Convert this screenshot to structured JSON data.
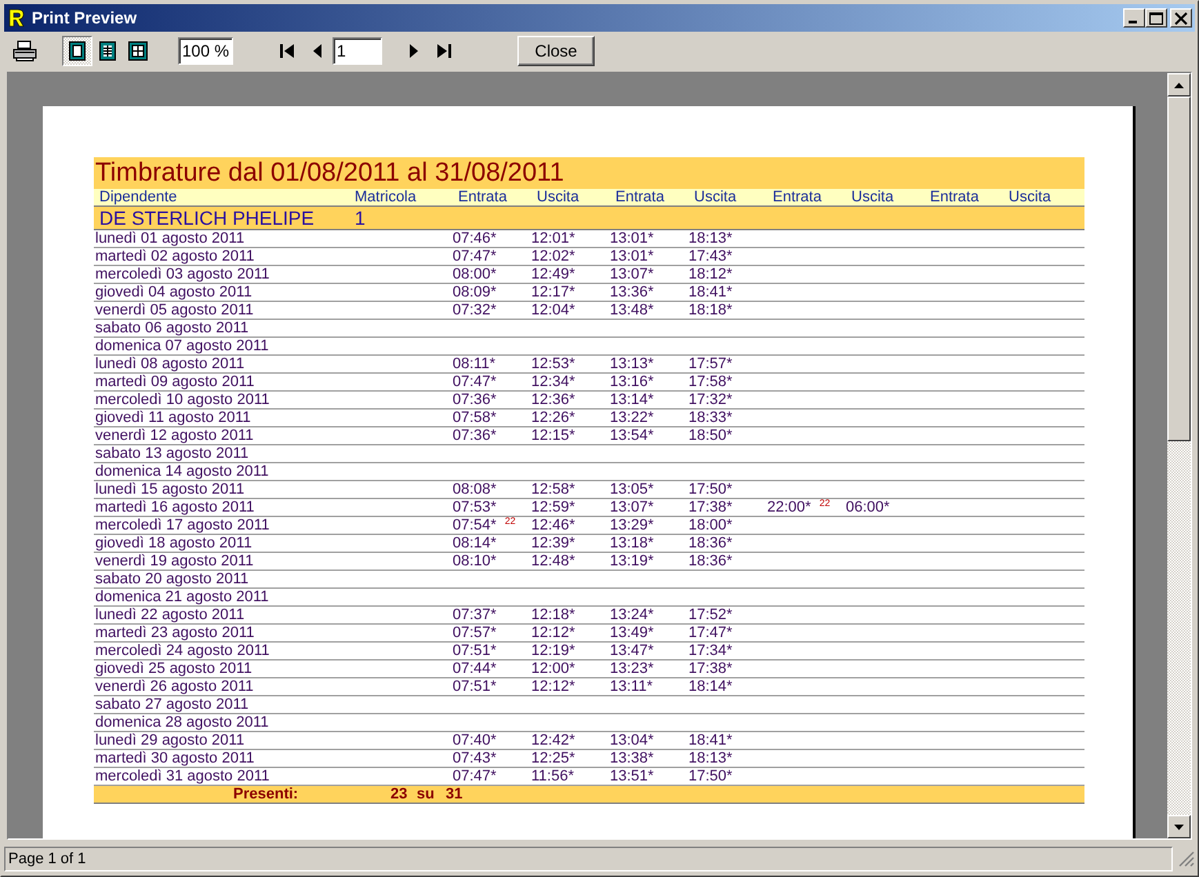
{
  "window": {
    "title": "Print Preview"
  },
  "toolbar": {
    "view_buttons": [
      {
        "selected": true
      },
      {
        "selected": false
      },
      {
        "selected": false
      }
    ],
    "zoom": "100 %",
    "page": "1",
    "close_button": "Close"
  },
  "report": {
    "title": "Timbrature dal 01/08/2011 al 31/08/2011",
    "columns": [
      "Dipendente",
      "Matricola",
      "Entrata",
      "Uscita",
      "Entrata",
      "Uscita",
      "Entrata",
      "Uscita",
      "Entrata",
      "Uscita"
    ],
    "employee": {
      "name": "DE STERLICH PHELIPE",
      "number": "1"
    },
    "rows": [
      {
        "date": "lunedì 01 agosto 2011",
        "times": [
          "07:46*",
          "12:01*",
          "13:01*",
          "18:13*"
        ]
      },
      {
        "date": "martedì 02 agosto 2011",
        "times": [
          "07:47*",
          "12:02*",
          "13:01*",
          "17:43*"
        ]
      },
      {
        "date": "mercoledì 03 agosto 2011",
        "times": [
          "08:00*",
          "12:49*",
          "13:07*",
          "18:12*"
        ]
      },
      {
        "date": "giovedì 04 agosto 2011",
        "times": [
          "08:09*",
          "12:17*",
          "13:36*",
          "18:41*"
        ]
      },
      {
        "date": "venerdì 05 agosto 2011",
        "times": [
          "07:32*",
          "12:04*",
          "13:48*",
          "18:18*"
        ]
      },
      {
        "date": "sabato 06 agosto 2011"
      },
      {
        "date": "domenica 07 agosto 2011"
      },
      {
        "date": "lunedì 08 agosto 2011",
        "times": [
          "08:11*",
          "12:53*",
          "13:13*",
          "17:57*"
        ]
      },
      {
        "date": "martedì 09 agosto 2011",
        "times": [
          "07:47*",
          "12:34*",
          "13:16*",
          "17:58*"
        ]
      },
      {
        "date": "mercoledì 10 agosto 2011",
        "times": [
          "07:36*",
          "12:36*",
          "13:14*",
          "17:32*"
        ]
      },
      {
        "date": "giovedì 11 agosto 2011",
        "times": [
          "07:58*",
          "12:26*",
          "13:22*",
          "18:33*"
        ]
      },
      {
        "date": "venerdì 12 agosto 2011",
        "times": [
          "07:36*",
          "12:15*",
          "13:54*",
          "18:50*"
        ]
      },
      {
        "date": "sabato 13 agosto 2011"
      },
      {
        "date": "domenica 14 agosto 2011"
      },
      {
        "date": "lunedì 15 agosto 2011",
        "times": [
          "08:08*",
          "12:58*",
          "13:05*",
          "17:50*"
        ]
      },
      {
        "date": "martedì 16 agosto 2011",
        "times": [
          "07:53*",
          "12:59*",
          "13:07*",
          "17:38*",
          "22:00* $^{22}$",
          "06:00*"
        ]
      },
      {
        "date": "mercoledì 17 agosto 2011",
        "times": [
          "07:54* $^{22}$",
          "12:46*",
          "13:29*",
          "18:00*"
        ]
      },
      {
        "date": "giovedì 18 agosto 2011",
        "times": [
          "08:14*",
          "12:39*",
          "13:18*",
          "18:36*"
        ]
      },
      {
        "date": "venerdì 19 agosto 2011",
        "times": [
          "08:10*",
          "12:48*",
          "13:19*",
          "18:36*"
        ]
      },
      {
        "date": "sabato 20 agosto 2011"
      },
      {
        "date": "domenica 21 agosto 2011"
      },
      {
        "date": "lunedì 22 agosto 2011",
        "times": [
          "07:37*",
          "12:18*",
          "13:24*",
          "17:52*"
        ]
      },
      {
        "date": "martedì 23 agosto 2011",
        "times": [
          "07:57*",
          "12:12*",
          "13:49*",
          "17:47*"
        ]
      },
      {
        "date": "mercoledì 24 agosto 2011",
        "times": [
          "07:51*",
          "12:19*",
          "13:47*",
          "17:34*"
        ]
      },
      {
        "date": "giovedì 25 agosto 2011",
        "times": [
          "07:44*",
          "12:00*",
          "13:23*",
          "17:38*"
        ]
      },
      {
        "date": "venerdì 26 agosto 2011",
        "times": [
          "07:51*",
          "12:12*",
          "13:11*",
          "18:14*"
        ]
      },
      {
        "date": "sabato 27 agosto 2011"
      },
      {
        "date": "domenica 28 agosto 2011"
      },
      {
        "date": "lunedì 29 agosto 2011",
        "times": [
          "07:40*",
          "12:42*",
          "13:04*",
          "18:41*"
        ]
      },
      {
        "date": "martedì 30 agosto 2011",
        "times": [
          "07:43*",
          "12:25*",
          "13:38*",
          "18:13*"
        ]
      },
      {
        "date": "mercoledì 31 agosto 2011",
        "times": [
          "07:47*",
          "11:56*",
          "13:51*",
          "17:50*"
        ]
      }
    ],
    "summary": {
      "label": "Presenti:",
      "present": "23",
      "separator": "su",
      "total": "31"
    }
  },
  "status_bar": {
    "text": "Page 1 of 1"
  }
}
